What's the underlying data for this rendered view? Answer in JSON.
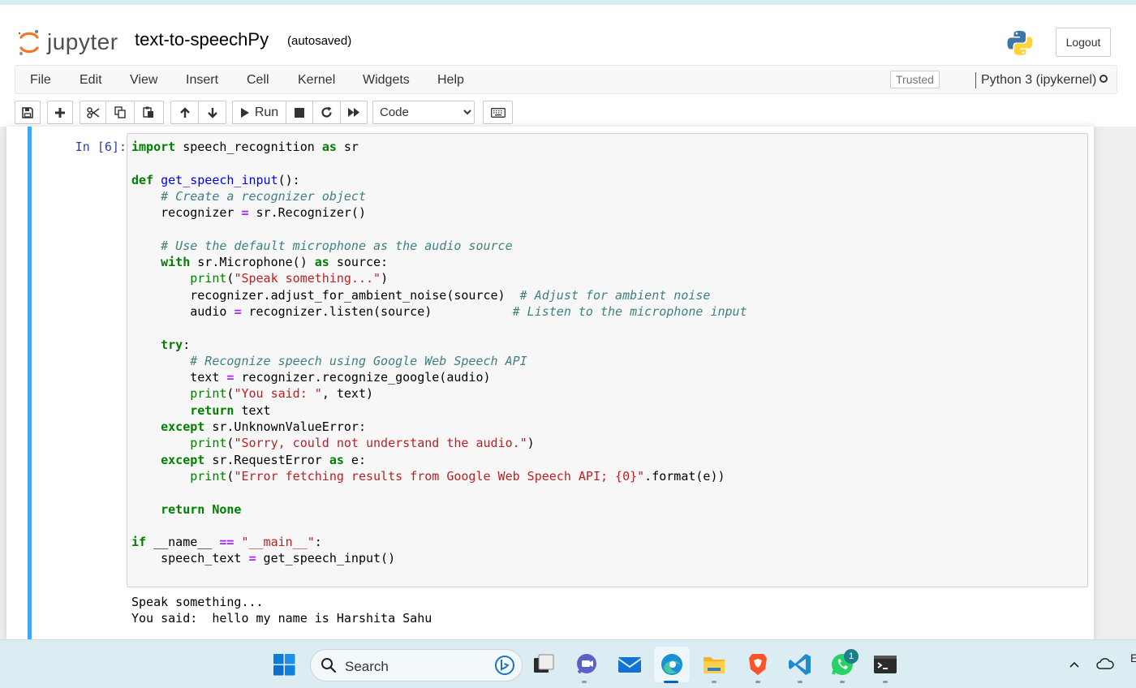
{
  "header": {
    "logo_text": "jupyter",
    "notebook_title": "text-to-speechPy",
    "autosave_status": "(autosaved)",
    "logout_label": "Logout"
  },
  "menubar": {
    "items": [
      "File",
      "Edit",
      "View",
      "Insert",
      "Cell",
      "Kernel",
      "Widgets",
      "Help"
    ],
    "trusted_label": "Trusted",
    "kernel_name": "Python 3 (ipykernel)"
  },
  "toolbar": {
    "run_label": "Run",
    "cell_type": "Code",
    "cell_type_options": [
      "Code"
    ],
    "icons": [
      "save-icon",
      "plus-icon",
      "cut-icon",
      "copy-icon",
      "paste-icon",
      "arrow-up-icon",
      "arrow-down-icon",
      "play-icon",
      "stop-icon",
      "restart-icon",
      "fast-forward-icon",
      "keyboard-icon"
    ]
  },
  "cell": {
    "prompt": "In [6]:",
    "code_lines": [
      "import speech_recognition as sr",
      "",
      "def get_speech_input():",
      "    # Create a recognizer object",
      "    recognizer = sr.Recognizer()",
      "",
      "    # Use the default microphone as the audio source",
      "    with sr.Microphone() as source:",
      "        print(\"Speak something...\")",
      "        recognizer.adjust_for_ambient_noise(source)  # Adjust for ambient noise",
      "        audio = recognizer.listen(source)           # Listen to the microphone input",
      "",
      "    try:",
      "        # Recognize speech using Google Web Speech API",
      "        text = recognizer.recognize_google(audio)",
      "        print(\"You said: \", text)",
      "        return text",
      "    except sr.UnknownValueError:",
      "        print(\"Sorry, could not understand the audio.\")",
      "    except sr.RequestError as e:",
      "        print(\"Error fetching results from Google Web Speech API; {0}\".format(e))",
      "",
      "    return None",
      "",
      "if __name__ == \"__main__\":",
      "    speech_text = get_speech_input()"
    ],
    "output_lines": [
      "Speak something...",
      "You said:  hello my name is Harshita Sahu"
    ]
  },
  "taskbar": {
    "search_label": "Search",
    "whatsapp_badge": "1",
    "apps": [
      "windows-start-icon",
      "search-icon",
      "bing-chat-icon",
      "task-view-icon",
      "teams-chat-icon",
      "mail-icon",
      "edge-browser-icon",
      "file-explorer-icon",
      "brave-browser-icon",
      "vscode-icon",
      "whatsapp-icon",
      "terminal-icon"
    ],
    "tray": [
      "chevron-up-icon",
      "onedrive-cloud-icon"
    ],
    "tray_edge_text": "E"
  },
  "colors": {
    "cell_selected_bar": "#42a5f5",
    "keyword": "#008000",
    "comment": "#408080",
    "string": "#ba2121",
    "function": "#0000ff",
    "operator": "#aa22ff",
    "prompt": "#303f9f",
    "jupyter_orange": "#f37726"
  }
}
